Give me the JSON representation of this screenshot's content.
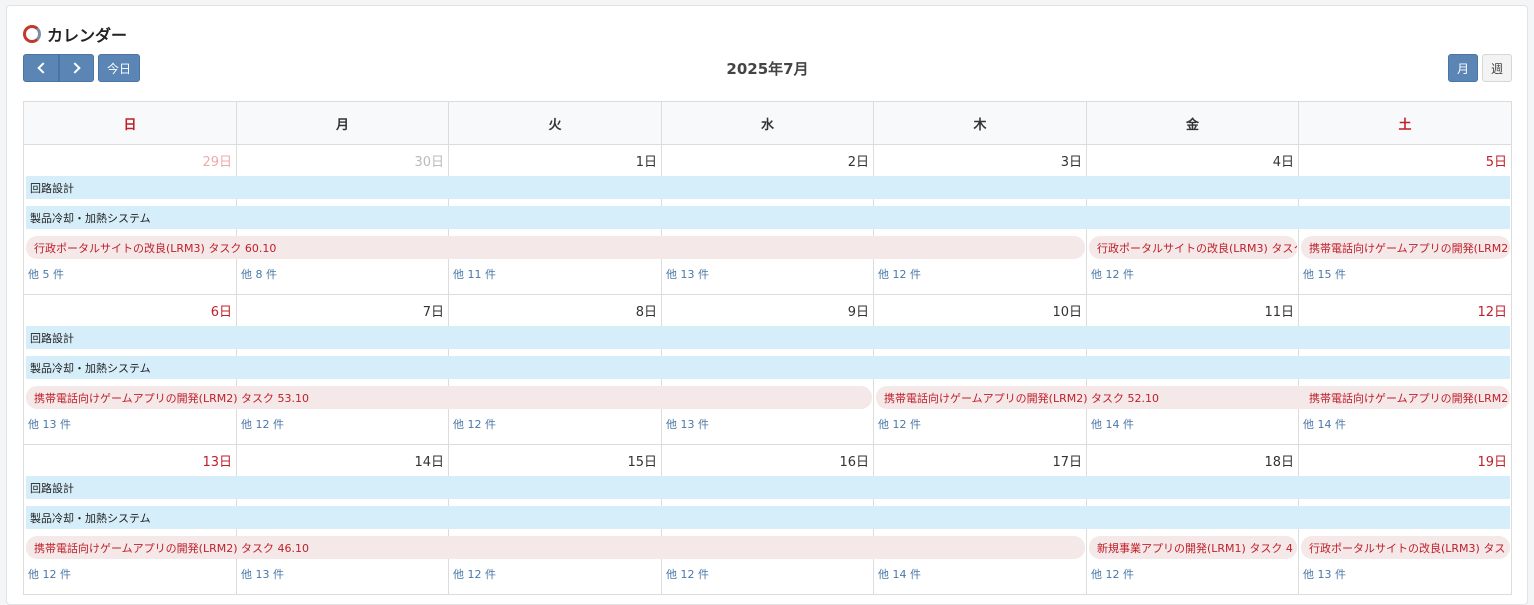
{
  "header": {
    "title": "カレンダー"
  },
  "toolbar": {
    "today_label": "今日",
    "month_title": "2025年7月",
    "month_view_label": "月",
    "week_view_label": "週"
  },
  "weekdays": [
    "日",
    "月",
    "火",
    "水",
    "木",
    "金",
    "土"
  ],
  "weeks": [
    {
      "days": [
        {
          "label": "29日",
          "more": "他 5 件"
        },
        {
          "label": "30日",
          "more": "他 8 件"
        },
        {
          "label": "1日",
          "more": "他 11 件"
        },
        {
          "label": "2日",
          "more": "他 13 件"
        },
        {
          "label": "3日",
          "more": "他 12 件"
        },
        {
          "label": "4日",
          "more": "他 12 件"
        },
        {
          "label": "5日",
          "more": "他 15 件"
        }
      ],
      "bars": [
        "回路設計",
        "製品冷却・加熱システム"
      ],
      "pink_events": [
        {
          "text": "行政ポータルサイトの改良(LRM3) タスク 60.10"
        },
        {
          "text": "行政ポータルサイトの改良(LRM3) タスク"
        },
        {
          "text": "携帯電話向けゲームアプリの開発(LRM2"
        }
      ]
    },
    {
      "days": [
        {
          "label": "6日",
          "more": "他 13 件"
        },
        {
          "label": "7日",
          "more": "他 12 件"
        },
        {
          "label": "8日",
          "more": "他 12 件"
        },
        {
          "label": "9日",
          "more": "他 13 件"
        },
        {
          "label": "10日",
          "more": "他 12 件"
        },
        {
          "label": "11日",
          "more": "他 14 件"
        },
        {
          "label": "12日",
          "more": "他 14 件"
        }
      ],
      "bars": [
        "回路設計",
        "製品冷却・加熱システム"
      ],
      "pink_events": [
        {
          "text": "携帯電話向けゲームアプリの開発(LRM2) タスク 53.10"
        },
        {
          "text": "携帯電話向けゲームアプリの開発(LRM2) タスク 52.10"
        },
        {
          "text": "携帯電話向けゲームアプリの開発(LRM2"
        }
      ]
    },
    {
      "days": [
        {
          "label": "13日",
          "more": "他 12 件"
        },
        {
          "label": "14日",
          "more": "他 13 件"
        },
        {
          "label": "15日",
          "more": "他 12 件"
        },
        {
          "label": "16日",
          "more": "他 12 件"
        },
        {
          "label": "17日",
          "more": "他 14 件"
        },
        {
          "label": "18日",
          "more": "他 12 件"
        },
        {
          "label": "19日",
          "more": "他 13 件"
        }
      ],
      "bars": [
        "回路設計",
        "製品冷却・加熱システム"
      ],
      "pink_events": [
        {
          "text": "携帯電話向けゲームアプリの開発(LRM2) タスク 46.10"
        },
        {
          "text": "新規事業アプリの開発(LRM1) タスク 4"
        },
        {
          "text": "行政ポータルサイトの改良(LRM3) タス"
        }
      ]
    }
  ]
}
